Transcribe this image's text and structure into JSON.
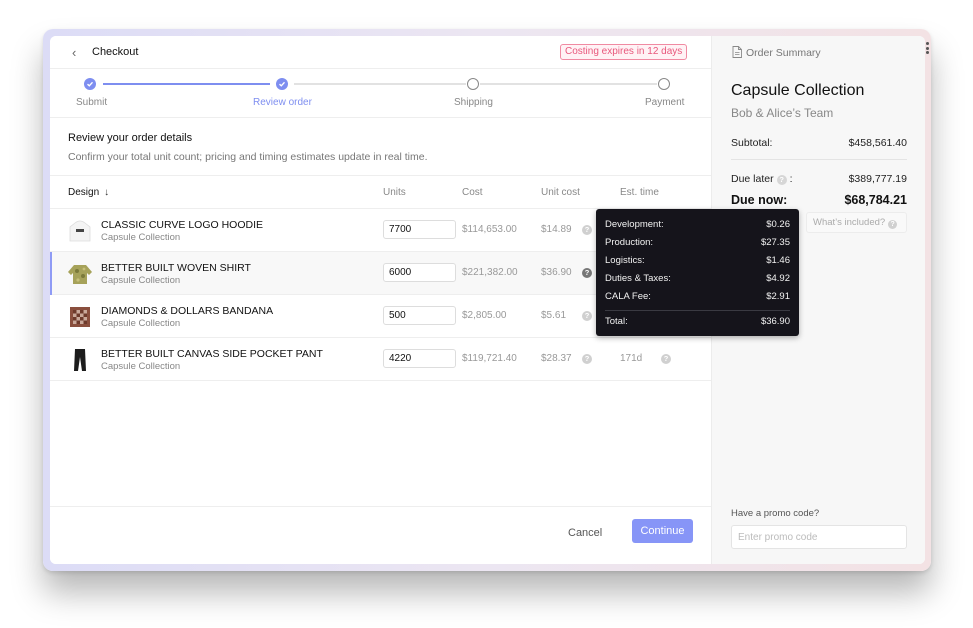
{
  "header": {
    "title": "Checkout",
    "back_icon": "chevron-left-icon",
    "expiry_badge": "Costing expires in 12 days"
  },
  "stepper": {
    "steps": [
      {
        "label": "Submit",
        "status": "complete"
      },
      {
        "label": "Review order",
        "status": "current"
      },
      {
        "label": "Shipping",
        "status": "pending"
      },
      {
        "label": "Payment",
        "status": "pending"
      }
    ]
  },
  "intro": {
    "title": "Review your order details",
    "subtitle": "Confirm your total unit count; pricing and timing estimates update in real time."
  },
  "table": {
    "columns": {
      "design": "Design",
      "units": "Units",
      "cost": "Cost",
      "unit_cost": "Unit cost",
      "est_time": "Est. time"
    },
    "sort_icon": "arrow-down-icon",
    "rows": [
      {
        "name": "CLASSIC CURVE LOGO HOODIE",
        "collection": "Capsule Collection",
        "units": "7700",
        "cost": "$114,653.00",
        "unit_cost": "$14.89",
        "est_time": "",
        "selected": false,
        "thumb": "hoodie"
      },
      {
        "name": "BETTER BUILT WOVEN SHIRT",
        "collection": "Capsule Collection",
        "units": "6000",
        "cost": "$221,382.00",
        "unit_cost": "$36.90",
        "est_time": "",
        "selected": true,
        "thumb": "shirt"
      },
      {
        "name": "DIAMONDS & DOLLARS BANDANA",
        "collection": "Capsule Collection",
        "units": "500",
        "cost": "$2,805.00",
        "unit_cost": "$5.61",
        "est_time": "",
        "selected": false,
        "thumb": "bandana"
      },
      {
        "name": "BETTER BUILT CANVAS SIDE POCKET PANT",
        "collection": "Capsule Collection",
        "units": "4220",
        "cost": "$119,721.40",
        "unit_cost": "$28.37",
        "est_time": "171d",
        "selected": false,
        "thumb": "pant"
      }
    ]
  },
  "tooltip": {
    "rows": [
      {
        "label": "Development:",
        "value": "$0.26"
      },
      {
        "label": "Production:",
        "value": "$27.35"
      },
      {
        "label": "Logistics:",
        "value": "$1.46"
      },
      {
        "label": "Duties & Taxes:",
        "value": "$4.92"
      },
      {
        "label": "CALA Fee:",
        "value": "$2.91"
      }
    ],
    "total_label": "Total:",
    "total_value": "$36.90"
  },
  "footer": {
    "cancel_label": "Cancel",
    "continue_label": "Continue"
  },
  "summary": {
    "header": "Order Summary",
    "collection": "Capsule Collection",
    "team": "Bob & Alice’s Team",
    "subtotal_label": "Subtotal:",
    "subtotal_value": "$458,561.40",
    "due_later_label": "Due later",
    "due_later_value": "$389,777.19",
    "due_now_label": "Due now:",
    "due_now_value": "$68,784.21",
    "whats_included": "What’s included?",
    "promo_label": "Have a promo code?",
    "promo_placeholder": "Enter promo code"
  },
  "colors": {
    "accent": "#8795f7",
    "badge": "#e8587c",
    "tooltip_bg": "#15141b"
  }
}
